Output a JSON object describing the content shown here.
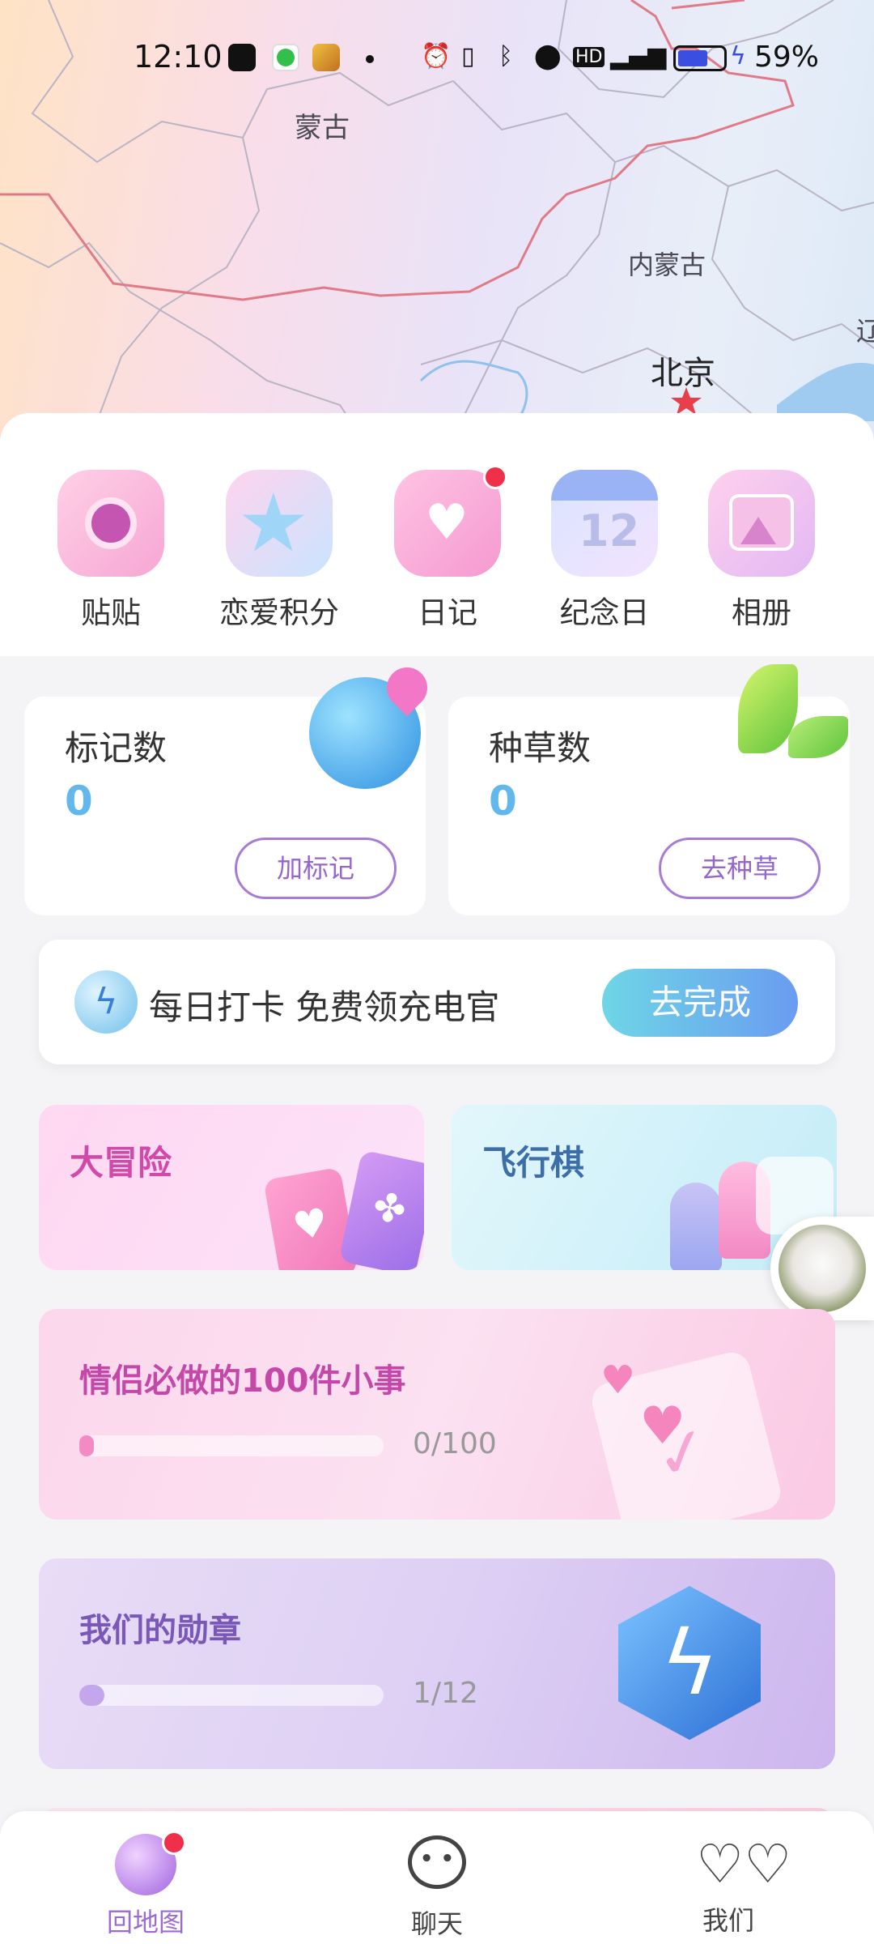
{
  "status_bar": {
    "time": "12:10",
    "battery": "59%"
  },
  "map": {
    "labels": {
      "mongolia": "蒙古",
      "inner_mongolia": "内蒙古",
      "beijing": "北京",
      "liao": "辽"
    }
  },
  "quick_actions": [
    {
      "label": "贴贴",
      "icon": "camera-icon",
      "badge": false
    },
    {
      "label": "恋爱积分",
      "icon": "star-icon",
      "badge": false
    },
    {
      "label": "日记",
      "icon": "diary-icon",
      "badge": true
    },
    {
      "label": "纪念日",
      "icon": "calendar-icon",
      "badge": false
    },
    {
      "label": "相册",
      "icon": "photo-album-icon",
      "badge": false
    }
  ],
  "stats": {
    "marks": {
      "title": "标记数",
      "value": "0",
      "button": "加标记"
    },
    "grass": {
      "title": "种草数",
      "value": "0",
      "button": "去种草"
    }
  },
  "checkin": {
    "text": "每日打卡 免费领充电官",
    "button": "去完成"
  },
  "games": {
    "adventure": "大冒险",
    "ludo": "飞行棋"
  },
  "tasks": {
    "title": "情侣必做的100件小事",
    "progress_text": "0/100",
    "progress": 0
  },
  "badges": {
    "title": "我们的勋章",
    "progress_text": "1/12",
    "progress": 0.0833
  },
  "tabs": [
    {
      "label": "回地图",
      "icon": "globe-icon",
      "active": true,
      "badge": true
    },
    {
      "label": "聊天",
      "icon": "chat-icon",
      "active": false,
      "badge": false
    },
    {
      "label": "我们",
      "icon": "hearts-icon",
      "active": false,
      "badge": false
    }
  ],
  "colors": {
    "accent": "#9566cc",
    "value_blue": "#62b8ec",
    "tab_active": "#9a6bd6",
    "badge_red": "#f0304a"
  }
}
